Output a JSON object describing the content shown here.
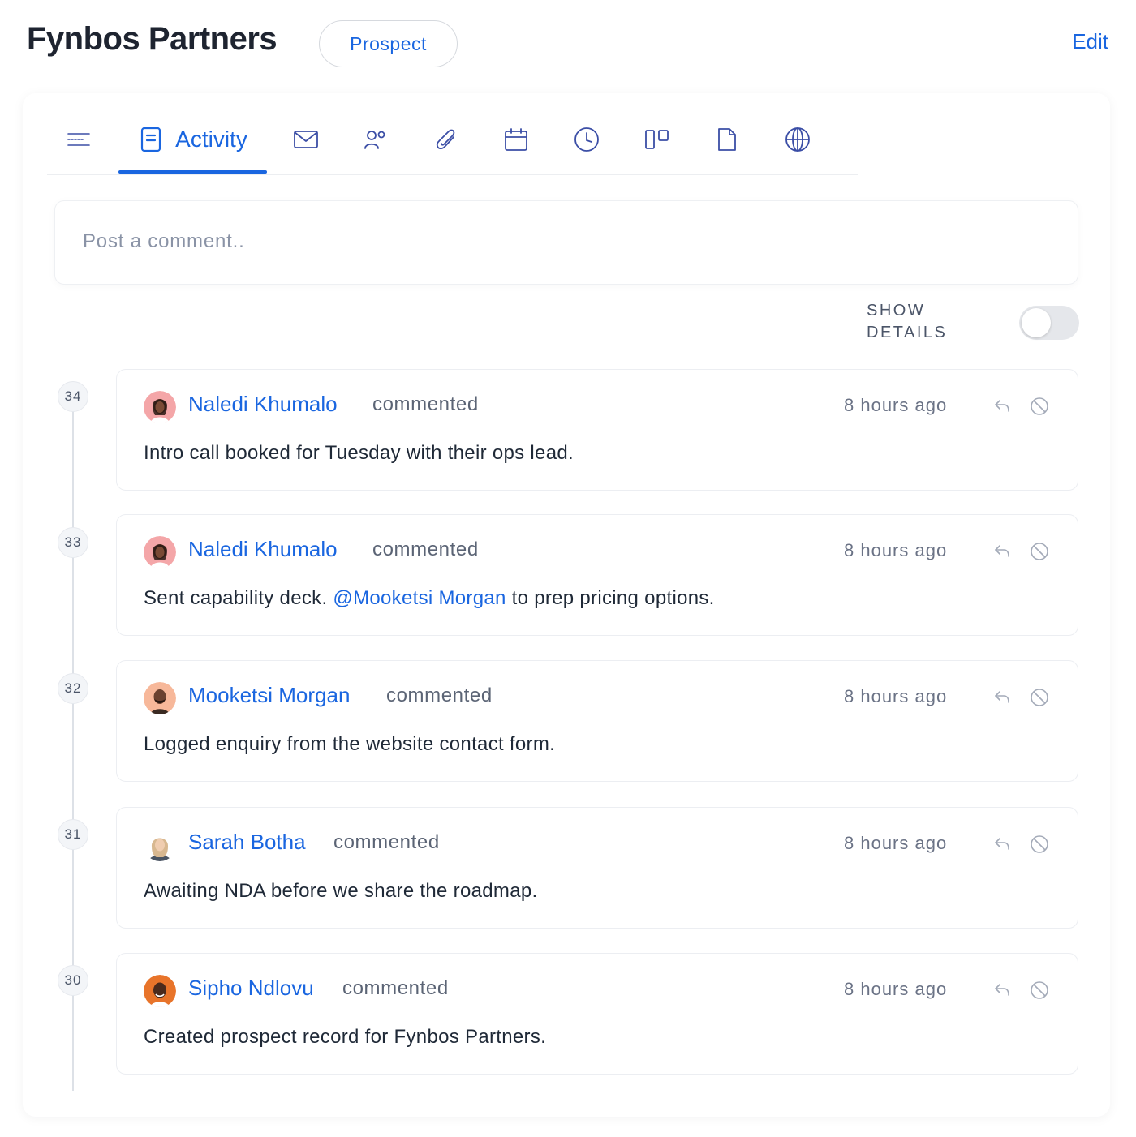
{
  "header": {
    "title": "Fynbos Partners",
    "status": "Prospect",
    "edit_label": "Edit"
  },
  "tabs": [
    {
      "id": "details",
      "icon": "list-lines-icon"
    },
    {
      "id": "activity",
      "icon": "document-lines-icon",
      "label": "Activity",
      "active": true
    },
    {
      "id": "email",
      "icon": "envelope-icon"
    },
    {
      "id": "contacts",
      "icon": "people-icon"
    },
    {
      "id": "attachments",
      "icon": "paperclip-icon"
    },
    {
      "id": "calendar",
      "icon": "calendar-icon"
    },
    {
      "id": "history",
      "icon": "clock-icon"
    },
    {
      "id": "board",
      "icon": "kanban-icon"
    },
    {
      "id": "files",
      "icon": "file-icon"
    },
    {
      "id": "web",
      "icon": "globe-icon"
    }
  ],
  "comment": {
    "placeholder": "Post a comment.."
  },
  "details_toggle": {
    "label_line1": "SHOW",
    "label_line2": "DETAILS",
    "on": false
  },
  "colors": {
    "accent": "#1a66e0",
    "text": "#1f2937",
    "muted": "#6b7386"
  },
  "entries": [
    {
      "number": "34",
      "author": "Naledi Khumalo",
      "verb": "commented",
      "time": "8 hours ago",
      "text": "Intro call booked for Tuesday with their ops lead."
    },
    {
      "number": "33",
      "author": "Naledi Khumalo",
      "verb": "commented",
      "time": "8 hours ago",
      "text_before": "Sent capability deck. ",
      "mention": "@Mooketsi Morgan",
      "text_after": " to prep pricing options."
    },
    {
      "number": "32",
      "author": "Mooketsi Morgan",
      "verb": "commented",
      "time": "8 hours ago",
      "text": "Logged enquiry from the website contact form."
    },
    {
      "number": "31",
      "author": "Sarah Botha",
      "verb": "commented",
      "time": "8 hours ago",
      "text": "Awaiting NDA before we share the roadmap."
    },
    {
      "number": "30",
      "author": "Sipho Ndlovu",
      "verb": "commented",
      "time": "8 hours ago",
      "text": "Created prospect record for Fynbos Partners."
    }
  ]
}
